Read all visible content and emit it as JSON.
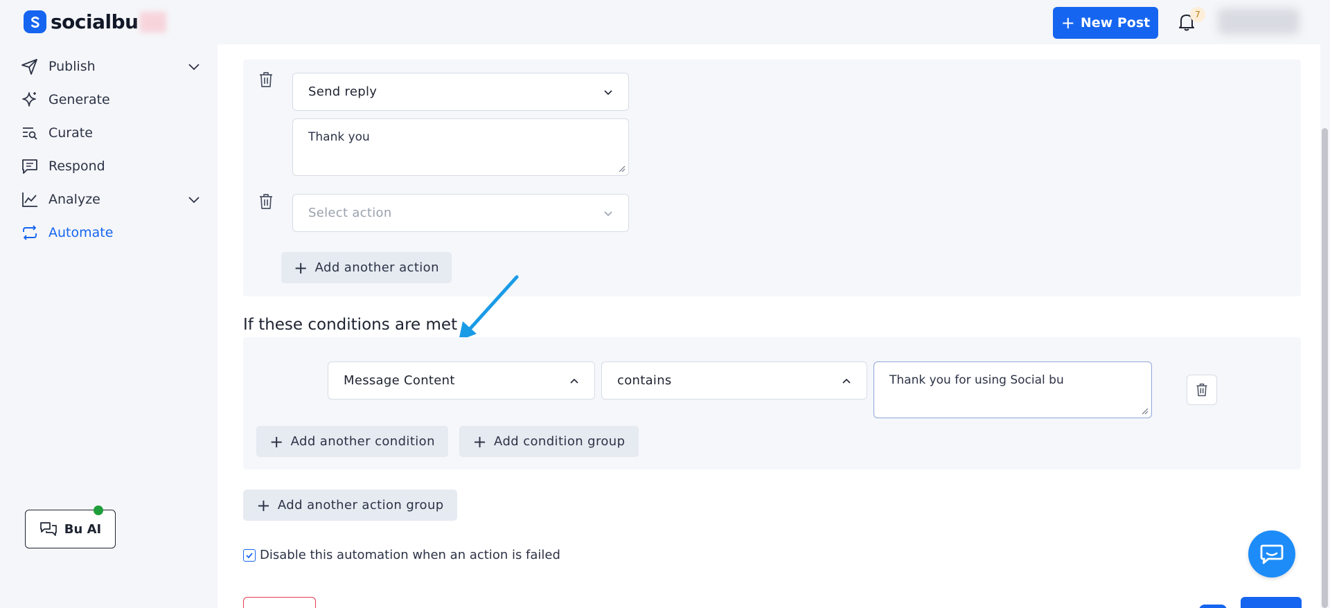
{
  "brand": {
    "name": "socialbu"
  },
  "header": {
    "new_post_label": "New Post",
    "notification_count": "7"
  },
  "sidebar": {
    "items": [
      {
        "label": "Publish",
        "has_chevron": true
      },
      {
        "label": "Generate"
      },
      {
        "label": "Curate"
      },
      {
        "label": "Respond"
      },
      {
        "label": "Analyze",
        "has_chevron": true
      },
      {
        "label": "Automate",
        "active": true
      }
    ],
    "bu_ai_label": "Bu AI"
  },
  "actions": {
    "action1_select": "Send reply",
    "action1_text": "Thank you",
    "action2_placeholder": "Select action",
    "add_action_label": "Add another action"
  },
  "conditions": {
    "title": "If these conditions are met",
    "field_select": "Message Content",
    "operator_select": "contains",
    "value_text": "Thank you for using Social bu",
    "add_condition_label": "Add another condition",
    "add_group_label": "Add condition group"
  },
  "add_action_group_label": "Add another action group",
  "disable_checkbox_label": "Disable this automation when an action is failed",
  "colors": {
    "accent": "#1565f0",
    "annotation_arrow": "#1a9be6",
    "help_bubble": "#1d8cf8",
    "danger": "#e53950"
  }
}
